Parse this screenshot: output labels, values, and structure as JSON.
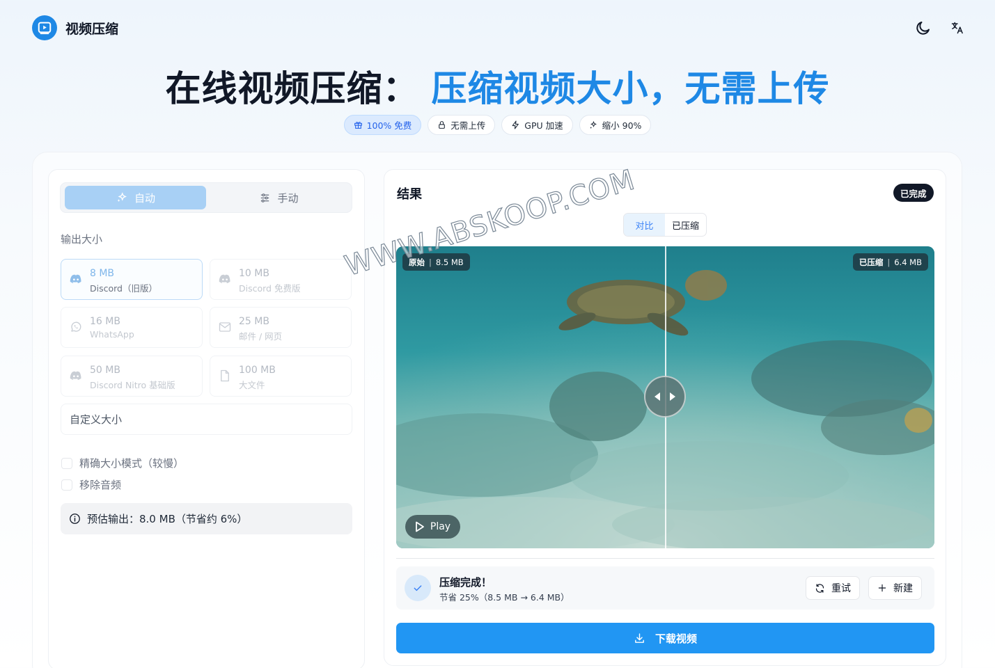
{
  "header": {
    "app_title": "视频压缩",
    "logo_icon": "video-player-icon",
    "theme_icon": "moon-icon",
    "lang_icon": "translate-icon"
  },
  "hero": {
    "title_black": "在线视频压缩：",
    "title_blue": "压缩视频大小，无需上传"
  },
  "pills": [
    {
      "label": "100% 免费",
      "icon": "gift-icon",
      "active": true
    },
    {
      "label": "无需上传",
      "icon": "lock-icon",
      "active": false
    },
    {
      "label": "GPU 加速",
      "icon": "lightning-icon",
      "active": false
    },
    {
      "label": "缩小 90%",
      "icon": "sparkle-icon",
      "active": false
    }
  ],
  "left": {
    "tabs": {
      "auto": "自动",
      "manual": "手动",
      "active": "auto"
    },
    "section_label": "输出大小",
    "options": [
      {
        "size": "8 MB",
        "desc": "Discord（旧版）",
        "icon": "discord-icon",
        "selected": true
      },
      {
        "size": "10 MB",
        "desc": "Discord 免费版",
        "icon": "discord-icon",
        "selected": false
      },
      {
        "size": "16 MB",
        "desc": "WhatsApp",
        "icon": "whatsapp-icon",
        "selected": false
      },
      {
        "size": "25 MB",
        "desc": "邮件 / 网页",
        "icon": "mail-icon",
        "selected": false
      },
      {
        "size": "50 MB",
        "desc": "Discord Nitro 基础版",
        "icon": "discord-icon",
        "selected": false
      },
      {
        "size": "100 MB",
        "desc": "大文件",
        "icon": "file-icon",
        "selected": false
      }
    ],
    "custom_size": "自定义大小",
    "checkboxes": {
      "precise": "精确大小模式（较慢）",
      "remove_audio": "移除音频"
    },
    "estimate": "预估输出：8.0 MB（节省约 6%）"
  },
  "right": {
    "title": "结果",
    "status_badge": "已完成",
    "toggle": {
      "compare": "对比",
      "compressed": "已压缩",
      "active": "compare"
    },
    "video": {
      "original_label": "原始",
      "original_size": "8.5 MB",
      "compressed_label": "已压缩",
      "compressed_size": "6.4 MB",
      "play_label": "Play",
      "slider_position_pct": 50
    },
    "done": {
      "heading": "压缩完成！",
      "detail": "节省 25%（8.5 MB → 6.4 MB）"
    },
    "buttons": {
      "retry": "重试",
      "new": "新建",
      "download": "下载视频"
    }
  },
  "watermark": "WWW.ABSKOOP.COM",
  "colors": {
    "accent": "#1e88e5",
    "download": "#2196f3",
    "badge_bg": "#111827"
  }
}
